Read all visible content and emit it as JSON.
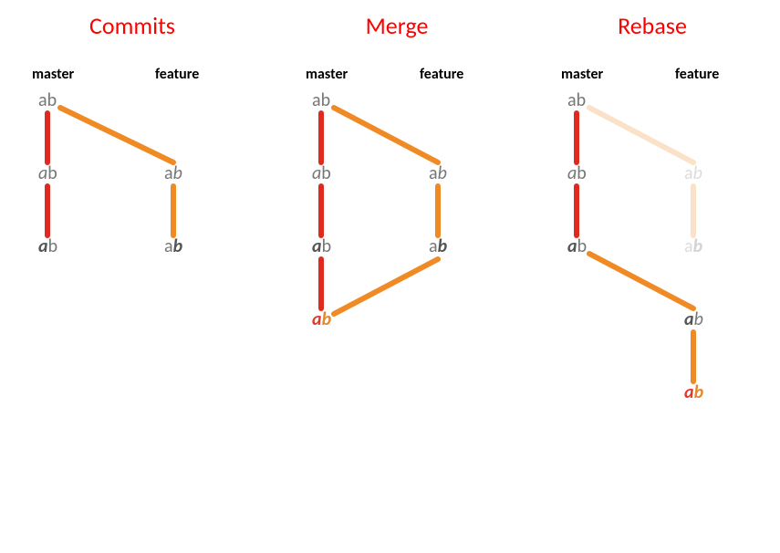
{
  "panels": {
    "commits": {
      "title": "Commits",
      "master_label": "master",
      "feature_label": "feature",
      "m1": "ab",
      "m2_a": "a",
      "m2_b": "b",
      "m3_a": "a",
      "m3_b": "b",
      "f1_a": "a",
      "f1_b": "b",
      "f2_a": "a",
      "f2_b": "b"
    },
    "merge": {
      "title": "Merge",
      "master_label": "master",
      "feature_label": "feature",
      "m1": "ab",
      "m2_a": "a",
      "m2_b": "b",
      "m3_a": "a",
      "m3_b": "b",
      "f1_a": "a",
      "f1_b": "b",
      "f2_a": "a",
      "f2_b": "b",
      "merge_a": "a",
      "merge_b": "b"
    },
    "rebase": {
      "title": "Rebase",
      "master_label": "master",
      "feature_label": "feature",
      "m1": "ab",
      "m2_a": "a",
      "m2_b": "b",
      "m3_a": "a",
      "m3_b": "b",
      "f1_a": "a",
      "f1_b": "b",
      "f2_a": "a",
      "f2_b": "b",
      "r1_a": "a",
      "r1_b": "b",
      "r2_a": "a",
      "r2_b": "b"
    }
  },
  "colors": {
    "title": "#ff0000",
    "master_line": "#e02a1f",
    "feature_line": "#f08a24"
  }
}
